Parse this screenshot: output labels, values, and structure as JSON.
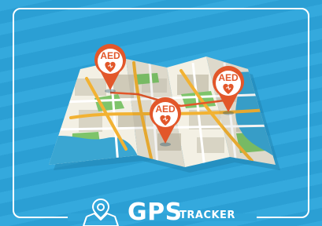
{
  "markers": [
    {
      "label": "AED"
    },
    {
      "label": "AED"
    },
    {
      "label": "AED"
    }
  ],
  "brand": {
    "main": "GPS",
    "sub": "TRACKER"
  },
  "colors": {
    "background": "#2fa4d8",
    "marker": "#e2572a",
    "water": "#3aa6d2",
    "park": "#7ec46a"
  },
  "icons": [
    "map-icon",
    "heart-pulse-icon",
    "gps-map-icon"
  ]
}
